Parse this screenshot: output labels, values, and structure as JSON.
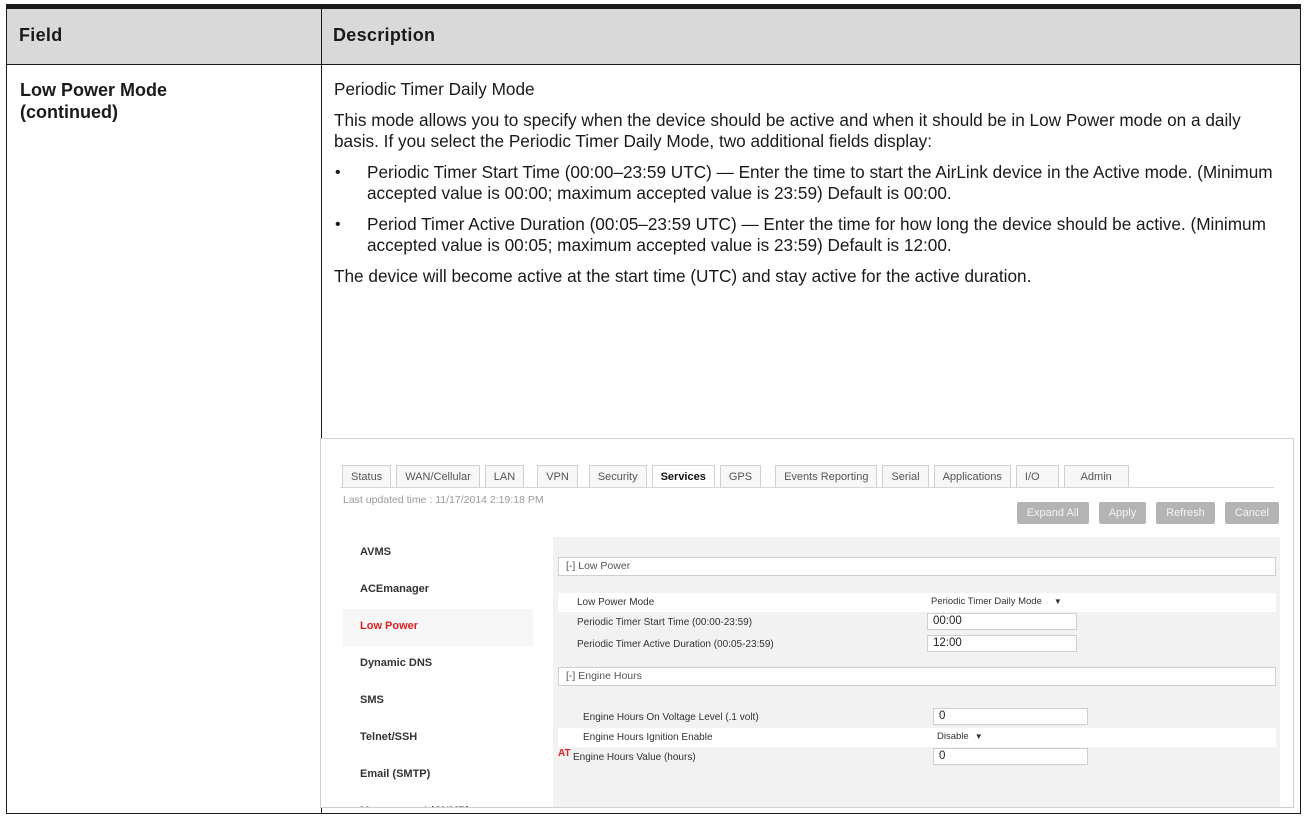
{
  "header": {
    "field": "Field",
    "description": "Description"
  },
  "field_label": {
    "line1": "Low Power Mode",
    "line2": "(continued)"
  },
  "description": {
    "title": "Periodic Timer Daily Mode",
    "intro": "This mode allows you to specify when the device should be active and when it should be in Low Power mode on a daily basis. If you select the Periodic Timer Daily Mode, two additional fields display:",
    "bullets": [
      "Periodic Timer Start Time (00:00–23:59 UTC) — Enter the time to start the AirLink device in the Active mode. (Minimum accepted value is 00:00; maximum accepted value is 23:59) Default is 00:00.",
      "Period Timer Active Duration (00:05–23:59 UTC) — Enter the time for how long the device should be active. (Minimum accepted value is 00:05; maximum accepted value is 23:59) Default is 12:00."
    ],
    "closing": "The device will become active at the start time (UTC) and stay active for the active duration."
  },
  "screenshot": {
    "tabs": [
      "Status",
      "WAN/Cellular",
      "LAN",
      "VPN",
      "Security",
      "Services",
      "GPS",
      "Events Reporting",
      "Serial",
      "Applications",
      "I/O",
      "Admin"
    ],
    "active_tab": "Services",
    "last_updated": "Last updated time : 11/17/2014 2:19:18 PM",
    "buttons": {
      "expand_all": "Expand All",
      "apply": "Apply",
      "refresh": "Refresh",
      "cancel": "Cancel"
    },
    "nav": [
      "AVMS",
      "ACEmanager",
      "Low Power",
      "Dynamic DNS",
      "SMS",
      "Telnet/SSH",
      "Email (SMTP)",
      "Management (SNMP)"
    ],
    "active_nav": "Low Power",
    "low_power": {
      "section": "[-] Low Power",
      "mode_label": "Low Power Mode",
      "mode_value": "Periodic Timer Daily Mode",
      "start_label": "Periodic Timer Start Time (00:00-23:59)",
      "start_value": "00:00",
      "duration_label": "Periodic Timer Active Duration (00:05-23:59)",
      "duration_value": "12:00"
    },
    "engine_hours": {
      "section": "[-] Engine Hours",
      "voltage_label": "Engine Hours On Voltage Level (.1 volt)",
      "voltage_value": "0",
      "ignition_label": "Engine Hours Ignition Enable",
      "ignition_value": "Disable",
      "value_marker": "AT",
      "value_label": "Engine Hours Value (hours)",
      "value_value": "0"
    },
    "colors": {
      "active_red": "#e02020",
      "button_gray": "#b4b4b4"
    }
  }
}
